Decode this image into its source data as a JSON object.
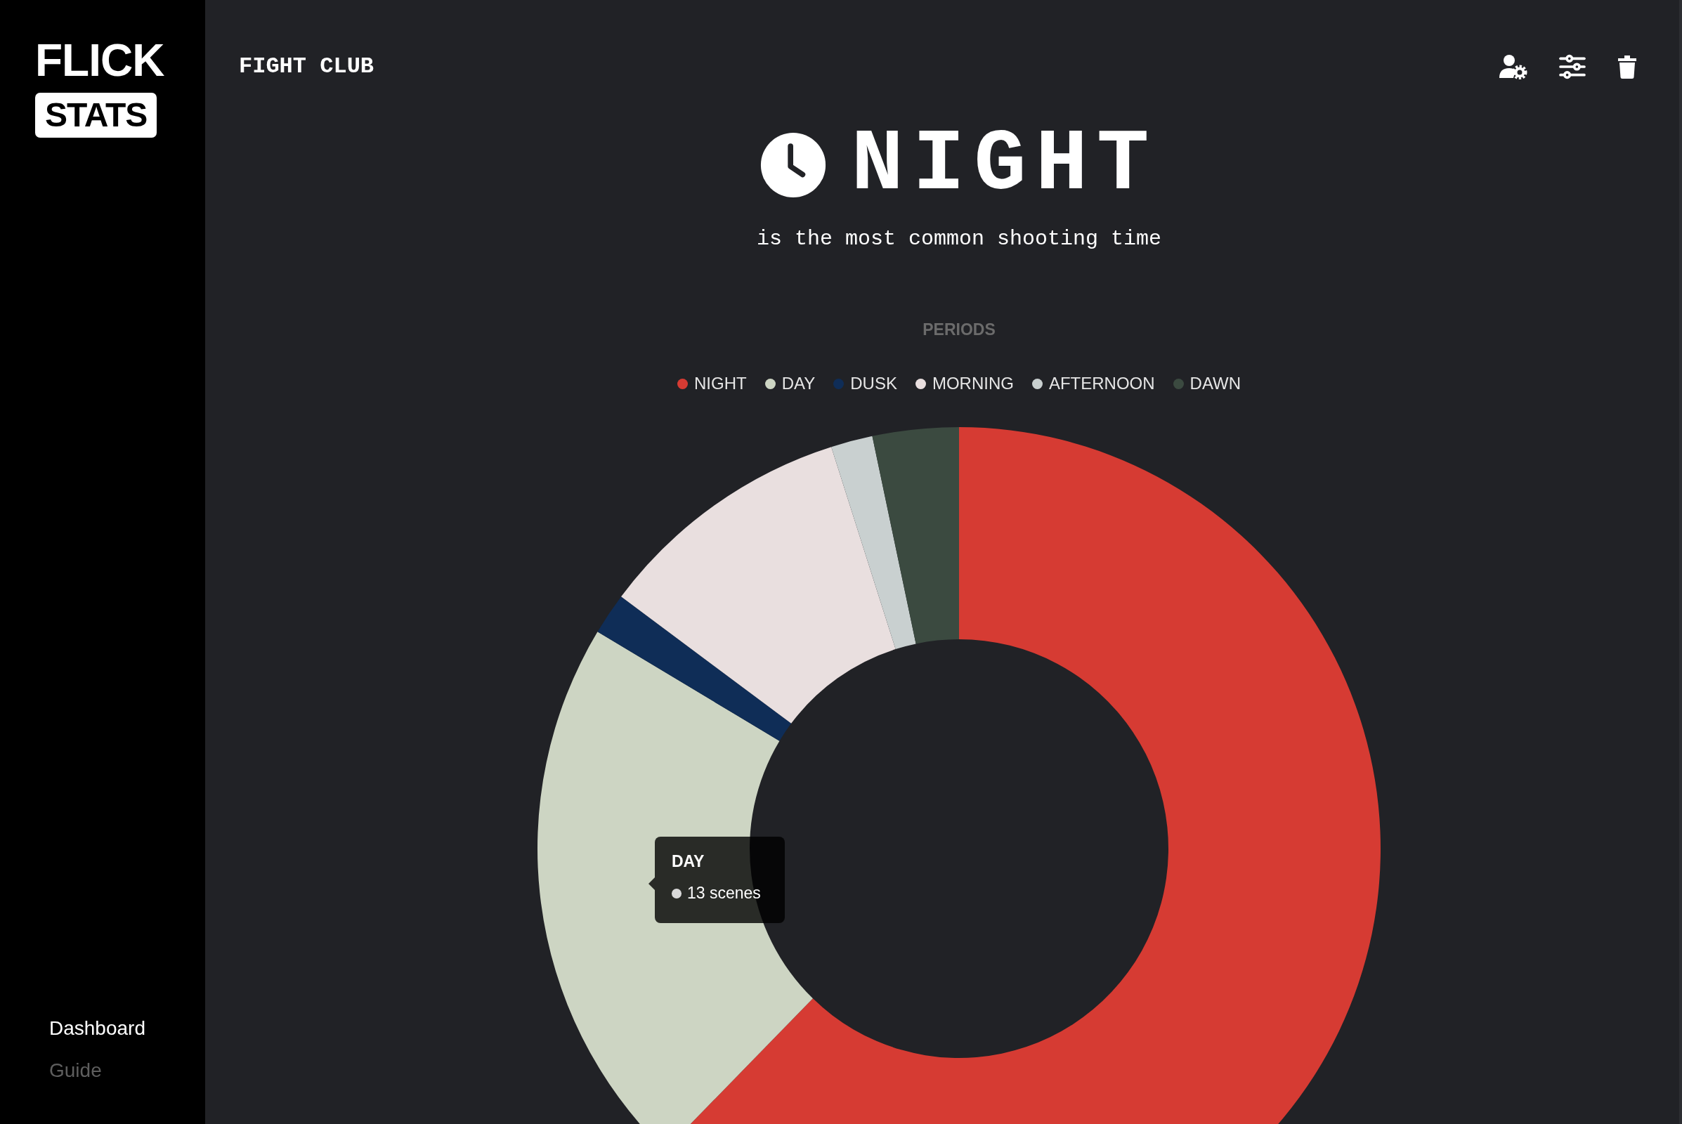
{
  "logo": {
    "top": "FLICK",
    "badge": "STATS"
  },
  "sidebar": {
    "items": [
      {
        "label": "Dashboard",
        "selected": true
      },
      {
        "label": "Guide",
        "selected": false
      }
    ]
  },
  "header": {
    "title": "FIGHT CLUB"
  },
  "hero": {
    "headline": "NIGHT",
    "subtitle": "is the most common shooting time"
  },
  "chart_data": {
    "type": "donut",
    "title": "PERIODS",
    "categories": [
      "NIGHT",
      "DAY",
      "DUSK",
      "MORNING",
      "AFTERNOON",
      "DAWN"
    ],
    "colors": [
      "#d63b33",
      "#cdd5c3",
      "#0f2d57",
      "#e9dfdf",
      "#c9d0d0",
      "#3b4a40"
    ],
    "values": [
      62.3,
      21.3,
      1.6,
      9.9,
      1.6,
      3.3
    ]
  },
  "tooltip": {
    "title": "DAY",
    "text": "13 scenes"
  }
}
